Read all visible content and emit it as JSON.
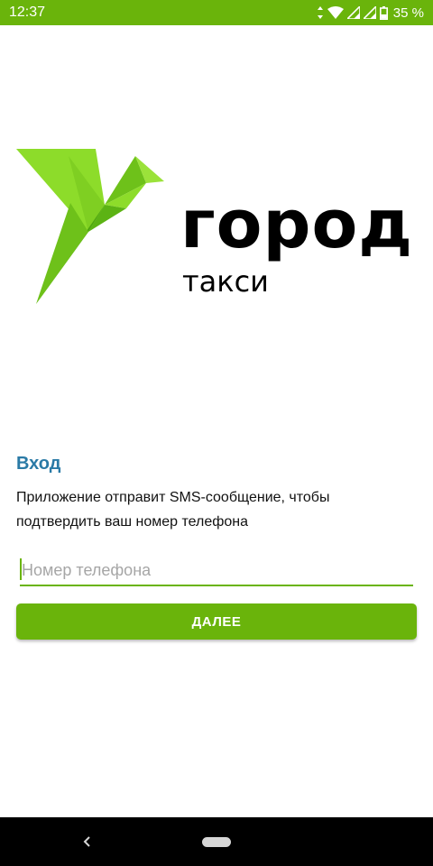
{
  "status_bar": {
    "time": "12:37",
    "battery": "35 %",
    "icons": [
      "data-arrows-icon",
      "wifi-icon",
      "signal-icon",
      "signal-icon",
      "battery-icon"
    ]
  },
  "brand": {
    "name": "город",
    "subtitle": "такси",
    "logo_icon": "origami-bird-logo",
    "logo_colors": [
      "#8ddc2a",
      "#6ec11a",
      "#4ea510"
    ]
  },
  "login": {
    "title": "Вход",
    "description": "Приложение отправит SMS-сообщение, чтобы подтвердить ваш номер телефона",
    "phone": {
      "value": "",
      "placeholder": "Номер телефона"
    },
    "next_label": "ДАЛЕЕ"
  },
  "nav_bar": {
    "back_icon": "back-chevron-icon",
    "home_icon": "home-pill-icon"
  },
  "colors": {
    "accent": "#6ab40b",
    "title": "#2a7aa6",
    "status_bar": "#6ab40b"
  }
}
